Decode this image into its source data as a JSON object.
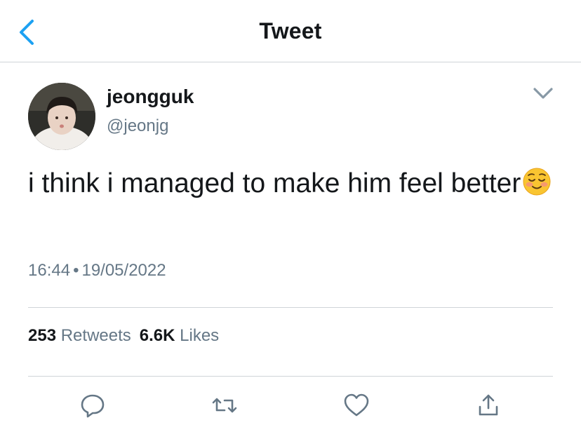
{
  "nav": {
    "title": "Tweet",
    "back_icon": "chevron-left-icon",
    "accent": "#1da1f2"
  },
  "tweet": {
    "display_name": "jeongguk",
    "handle": "@jeonjg",
    "text": "i think i managed to make him feel better",
    "emoji": "☺️",
    "time": "16:44",
    "separator": "•",
    "date": "19/05/2022",
    "menu_icon": "chevron-down-icon"
  },
  "stats": {
    "retweets_count": "253",
    "retweets_label": "Retweets",
    "likes_count": "6.6K",
    "likes_label": "Likes"
  },
  "actions": [
    {
      "name": "reply",
      "icon": "reply-icon"
    },
    {
      "name": "retweet",
      "icon": "retweet-icon"
    },
    {
      "name": "like",
      "icon": "heart-icon"
    },
    {
      "name": "share",
      "icon": "share-icon"
    }
  ],
  "colors": {
    "text": "#14171a",
    "secondary": "#657786",
    "divider": "#d0d4d8",
    "icon": "#657786"
  }
}
